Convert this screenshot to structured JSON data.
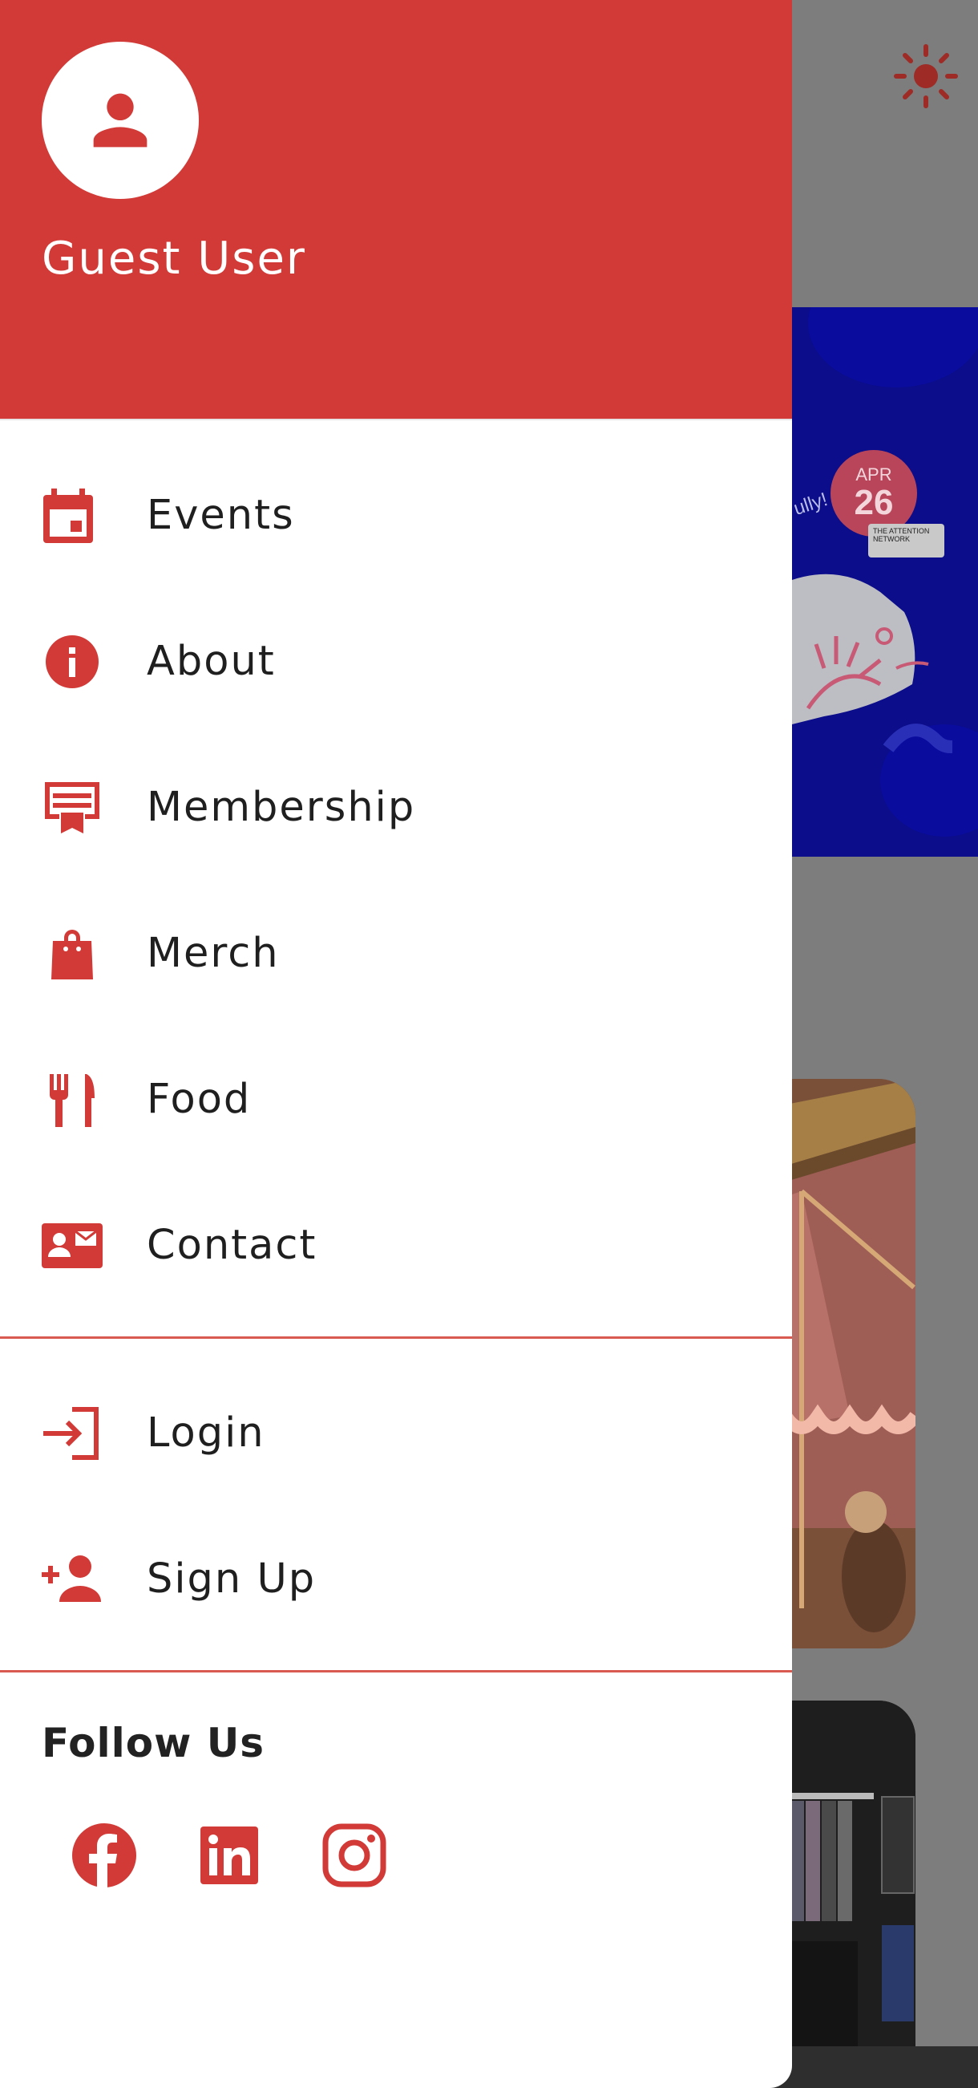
{
  "drawer": {
    "user_name": "Guest User",
    "menu": [
      {
        "label": "Events",
        "icon": "calendar-icon"
      },
      {
        "label": "About",
        "icon": "info-icon"
      },
      {
        "label": "Membership",
        "icon": "membership-card-icon"
      },
      {
        "label": "Merch",
        "icon": "shopping-bag-icon"
      },
      {
        "label": "Food",
        "icon": "fork-knife-icon"
      },
      {
        "label": "Contact",
        "icon": "contact-card-icon"
      }
    ],
    "auth": [
      {
        "label": "Login",
        "icon": "login-icon"
      },
      {
        "label": "Sign Up",
        "icon": "add-person-icon"
      }
    ],
    "follow_label": "Follow Us",
    "social": [
      "facebook-icon",
      "linkedin-icon",
      "instagram-icon"
    ]
  },
  "background": {
    "banner": {
      "date_month": "APR",
      "date_day": "26",
      "tag_text": "THE ATTENTION NETWORK",
      "side_text": "ully!"
    }
  },
  "colors": {
    "brand": "#d13a36",
    "header_bg": "#d13a36",
    "scrim": "#7d7d7d",
    "divider": "#d95a50"
  }
}
